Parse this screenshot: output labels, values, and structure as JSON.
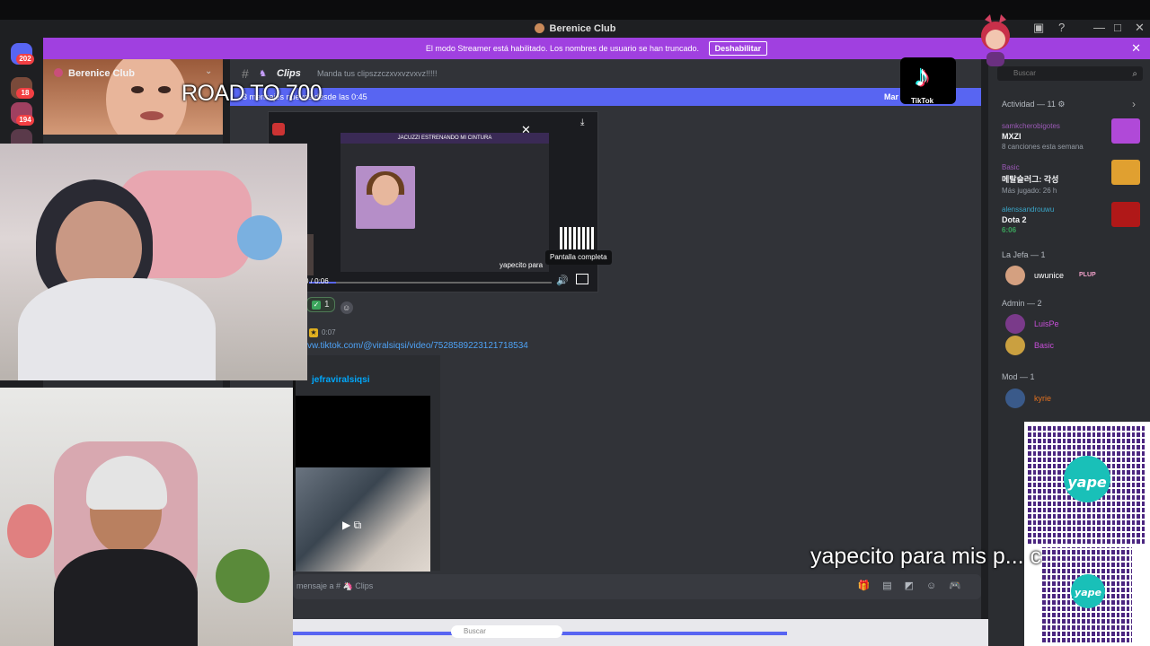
{
  "window": {
    "title": "Berenice Club",
    "controls": [
      "—",
      "□",
      "✕"
    ]
  },
  "guilds": {
    "badges": [
      "202",
      "18",
      "194"
    ]
  },
  "banner": {
    "text": "El modo Streamer está habilitado. Los nombres de usuario se han truncado.",
    "button": "Deshabilitar",
    "close": "✕"
  },
  "server": {
    "name": "Berenice Club"
  },
  "channel": {
    "name": "Clips",
    "topic": "Manda tus clipszzczxvxvzvxvz!!!!!"
  },
  "new_messages": {
    "text": "3 mensajes nuevos desde las 0:45",
    "mark": "Mar"
  },
  "overlay_text": {
    "road": "ROAD TO 700",
    "yape_caption": "yapecito para mis p... c"
  },
  "clip": {
    "inner_title": "JACUZZI ESTRENANDO MI CINTURA",
    "time": "0 / 0:06",
    "caption": "yapecito para",
    "tooltip": "Pantalla completa"
  },
  "reactions": {
    "count": "1"
  },
  "message2": {
    "time": "0:07",
    "link": "vw.tiktok.com/@viralsiqsi/video/7528589223121718534",
    "embed_author": "jefraviralsiqsi"
  },
  "composer": {
    "placeholder": "mensaje a # 🦄 Clips"
  },
  "taskbar": {
    "search": "Buscar"
  },
  "right_panel": {
    "search": "Buscar",
    "activity_header": "Actividad — 11 ⚙",
    "activities": [
      {
        "user": "samkcherobigotes",
        "title": "MXZI",
        "sub": "8 canciones esta semana",
        "color": "#b049d8"
      },
      {
        "user": "Basic",
        "title": "메탈슬러그: 각성",
        "sub": "Más jugado: 26 h",
        "color": "#e0a030"
      },
      {
        "user": "alenssandrouwu",
        "title": "Dota 2",
        "sub": "6:06",
        "color": "#b01818"
      }
    ],
    "roles": [
      {
        "name": "La Jefa — 1",
        "members": [
          {
            "name": "uwunice",
            "tag": "PLUP",
            "color": "#ffffff"
          }
        ]
      },
      {
        "name": "Admin — 2",
        "members": [
          {
            "name": "LuisPe",
            "color": "#c74fd8"
          },
          {
            "name": "Basic",
            "color": "#c74fd8"
          }
        ]
      },
      {
        "name": "Mod — 1",
        "members": [
          {
            "name": "kyrie",
            "color": "#e07020"
          }
        ]
      }
    ]
  },
  "tiktok": {
    "label": "TikTok"
  },
  "yape": {
    "brand": "yape"
  }
}
